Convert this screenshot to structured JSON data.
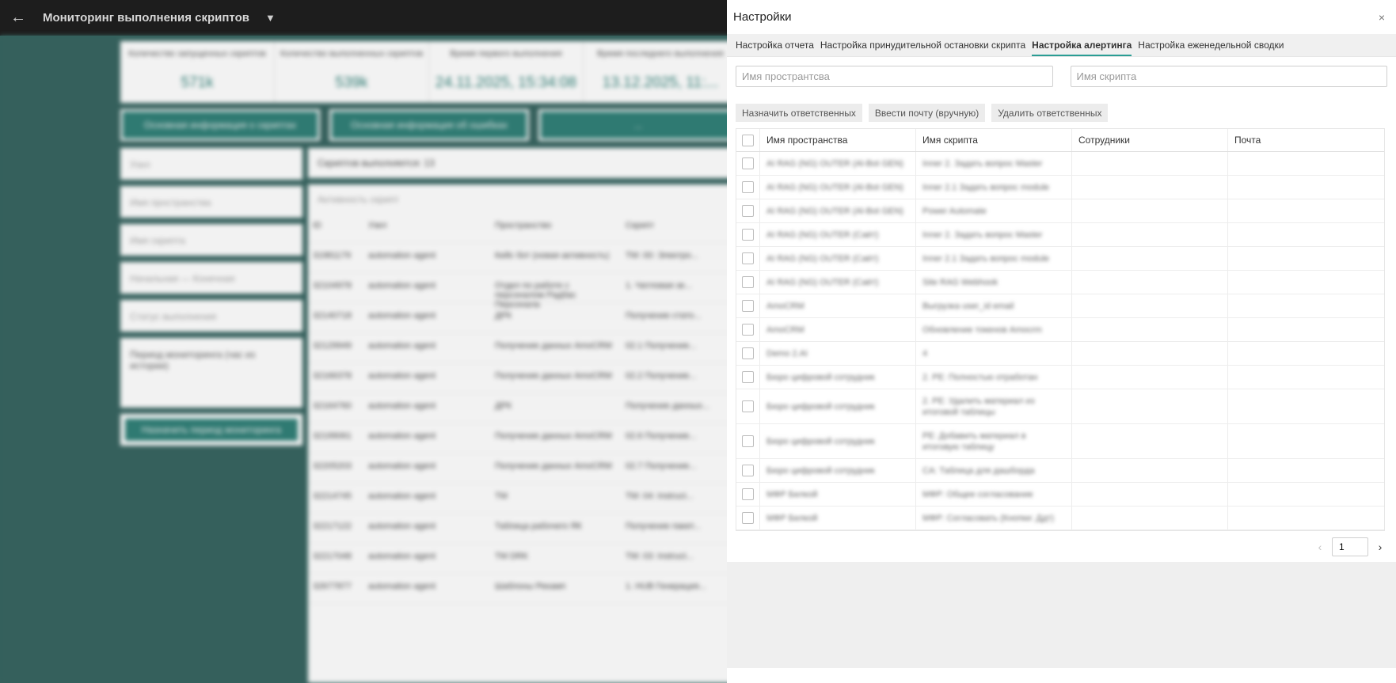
{
  "app": {
    "title": "Мониторинг выполнения скриптов",
    "back_icon": "←",
    "filter_icon": "▼"
  },
  "background": {
    "stats": [
      {
        "label": "Количество запущенных скриптов",
        "value": "571k"
      },
      {
        "label": "Количество выполненных скриптов",
        "value": "539k"
      },
      {
        "label": "Время первого выполнения",
        "value": "24.11.2025, 15:34:08"
      },
      {
        "label": "Время последнего выполнения",
        "value": "13.12.2025, 11:..."
      }
    ],
    "buttons": [
      "Основная информация о скриптах",
      "Основная информация об ошибках",
      "..."
    ],
    "filters": [
      "Узел",
      "Имя пространства",
      "Имя скрипта",
      "Начальная — Конечная",
      "Статус выполнения",
      "Период мониторинга (час из истории)",
      "Назначить период мониторинга"
    ],
    "count_text": "Скриптов выполняется: 13",
    "search_placeholder": "Активность скрипт",
    "table_header": [
      "ID",
      "Узел",
      "Пространство",
      "Скрипт"
    ],
    "rows": [
      [
        "31981179",
        "automation agent",
        "Кейс бот (новая активность)",
        "TM: 00: Электро..."
      ],
      [
        "32104978",
        "automation agent",
        "Отдел по работе с персоналом Радбас Персонала",
        "1. Чатловая зе..."
      ],
      [
        "32140718",
        "automation agent",
        "ДРК",
        "Получение стато..."
      ],
      [
        "32129949",
        "automation agent",
        "Получение данных AmoCRM",
        "02.1 Получение..."
      ],
      [
        "32166378",
        "automation agent",
        "Получение данных AmoCRM",
        "02.2 Получение..."
      ],
      [
        "32164760",
        "automation agent",
        "ДРК",
        "Получение данных..."
      ],
      [
        "32199061",
        "automation agent",
        "Получение данных AmoCRM",
        "02.6 Получение..."
      ],
      [
        "32205203",
        "automation agent",
        "Получение данных AmoCRM",
        "02.7 Получение..."
      ],
      [
        "32214745",
        "automation agent",
        "ТМ",
        "ТМ: 04: Instruct..."
      ],
      [
        "32217122",
        "automation agent",
        "Таблица рабочего ЯК",
        "Получение пакет..."
      ],
      [
        "32217048",
        "automation agent",
        "ТМ DRK",
        "ТМ: 03: Instruct..."
      ],
      [
        "32677877",
        "automation agent",
        "Шаблоны Рекамп",
        "1. HUB Генерация..."
      ]
    ]
  },
  "drawer": {
    "title": "Настройки",
    "close_icon": "×",
    "tabs": [
      {
        "label": "Настройка отчета",
        "active": false
      },
      {
        "label": "Настройка принудительной остановки скрипта",
        "active": false
      },
      {
        "label": "Настройка алертинга",
        "active": true
      },
      {
        "label": "Настройка еженедельной сводки",
        "active": false
      }
    ],
    "space_placeholder": "Имя пространтсва",
    "script_placeholder": "Имя скрипта",
    "actions": {
      "assign": "Назначить ответственных",
      "enter_email": "Ввести почту (вручную)",
      "delete": "Удалить ответственных"
    },
    "columns": {
      "space": "Имя пространства",
      "script": "Имя скрипта",
      "employees": "Сотрудники",
      "email": "Почта"
    },
    "rows": [
      {
        "space": "AI RAG (NG) OUTER (Al-Bot GEN)",
        "script": "Inner 2. Задать вопрос Master",
        "employees": "",
        "email": ""
      },
      {
        "space": "AI RAG (NG) OUTER (Al-Bot GEN)",
        "script": "Inner 2.1 Задать вопрос module",
        "employees": "",
        "email": ""
      },
      {
        "space": "AI RAG (NG) OUTER (Al-Bot GEN)",
        "script": "Power Automate",
        "employees": "",
        "email": ""
      },
      {
        "space": "AI RAG (NG) OUTER (Саёт)",
        "script": "Inner 2. Задать вопрос Master",
        "employees": "",
        "email": ""
      },
      {
        "space": "AI RAG (NG) OUTER (Саёт)",
        "script": "Inner 2.1 Задать вопрос module",
        "employees": "",
        "email": ""
      },
      {
        "space": "AI RAG (NG) OUTER (Саёт)",
        "script": "Site RAG Webhook",
        "employees": "",
        "email": ""
      },
      {
        "space": "AmoCRM",
        "script": "Выгрузка user_id email",
        "employees": "",
        "email": ""
      },
      {
        "space": "AmoCRM",
        "script": "Обновление токенов Amocrm",
        "employees": "",
        "email": ""
      },
      {
        "space": "Demo 2.AI",
        "script": "4",
        "employees": "",
        "email": ""
      },
      {
        "space": "Бюро цифровой сотрудник",
        "script": "2. PE: Полностью отработан",
        "employees": "",
        "email": ""
      },
      {
        "space": "Бюро цифровой сотрудник",
        "script": "2. PE: Удалить материал из итоговой таблицы",
        "employees": "",
        "email": ""
      },
      {
        "space": "Бюро цифровой сотрудник",
        "script": "PE: Добавить материал в итоговую таблицу",
        "employees": "",
        "email": ""
      },
      {
        "space": "Бюро цифровой сотрудник",
        "script": "CA: Таблица для дашборда",
        "employees": "",
        "email": ""
      },
      {
        "space": "МФР Белкой",
        "script": "МФР: Общее согласование",
        "employees": "",
        "email": ""
      },
      {
        "space": "МФР Белкой",
        "script": "МФР: Согласовать (Кнопки: Ддт)",
        "employees": "",
        "email": ""
      }
    ],
    "pagination": {
      "prev_icon": "‹",
      "page": "1",
      "next_icon": "›"
    }
  }
}
